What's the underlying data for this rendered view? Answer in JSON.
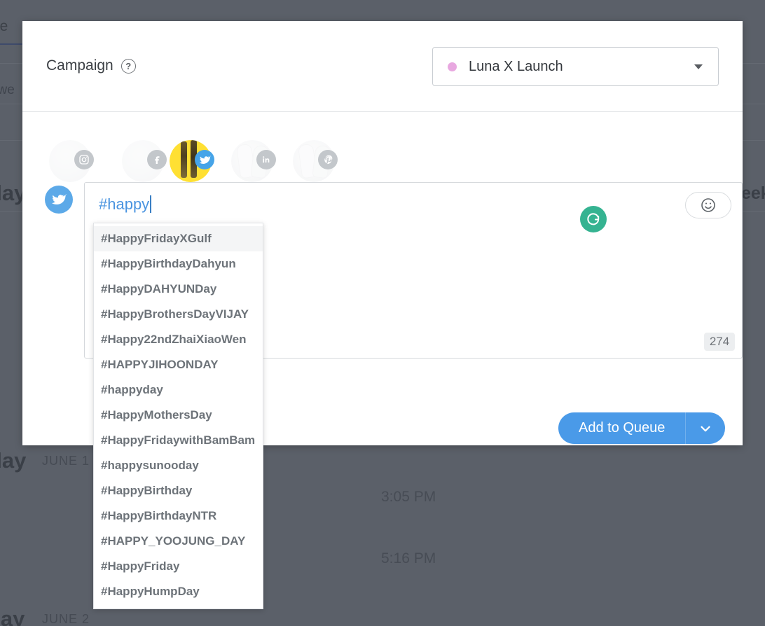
{
  "background": {
    "tab_fragment": "ue",
    "subtext_fragment": "t we",
    "week_label_fragment": "eek",
    "day_fragment_1": "day",
    "day_fragment_2": "day",
    "date_2": "JUNE 1",
    "day_fragment_3": "day",
    "date_3": "JUNE 2",
    "time_1": "3:05 PM",
    "time_2": "5:16 PM"
  },
  "modal": {
    "campaign": {
      "label": "Campaign",
      "help_icon": "question-circle-icon",
      "selected_value": "Luna X Launch",
      "dot_color": "#e8a8e0",
      "caret_icon": "caret-down-icon"
    },
    "accounts": [
      {
        "network": "instagram",
        "icon": "instagram-icon",
        "state": "inactive"
      },
      {
        "network": "facebook",
        "icon": "facebook-icon",
        "state": "inactive"
      },
      {
        "network": "twitter",
        "icon": "twitter-icon",
        "state": "active"
      },
      {
        "network": "linkedin",
        "icon": "linkedin-icon",
        "state": "inactive"
      },
      {
        "network": "pinterest",
        "icon": "pinterest-icon",
        "state": "inactive"
      }
    ],
    "composer": {
      "account_icon": "twitter-icon",
      "text_value": "#happy",
      "text_color": "#4a94e0",
      "emoji_icon": "smiley-face-icon",
      "refresh_icon": "refresh-icon",
      "refresh_color": "#35b391",
      "char_count": "274"
    },
    "autocomplete": {
      "items": [
        "#HappyFridayXGulf",
        "#HappyBirthdayDahyun",
        "#HappyDAHYUNDay",
        "#HappyBrothersDayVIJAY",
        "#Happy22ndZhaiXiaoWen",
        "#HAPPYJIHOONDAY",
        "#happyday",
        "#HappyMothersDay",
        "#HappyFridaywithBamBam",
        "#happysunooday",
        "#HappyBirthday",
        "#HappyBirthdayNTR",
        "#HAPPY_YOOJUNG_DAY",
        "#HappyFriday",
        "#HappyHumpDay"
      ],
      "highlighted_index": 0
    },
    "footer": {
      "queue_label": "Add to Queue",
      "queue_caret_icon": "chevron-down-icon",
      "queue_color": "#4a9ae8"
    }
  }
}
